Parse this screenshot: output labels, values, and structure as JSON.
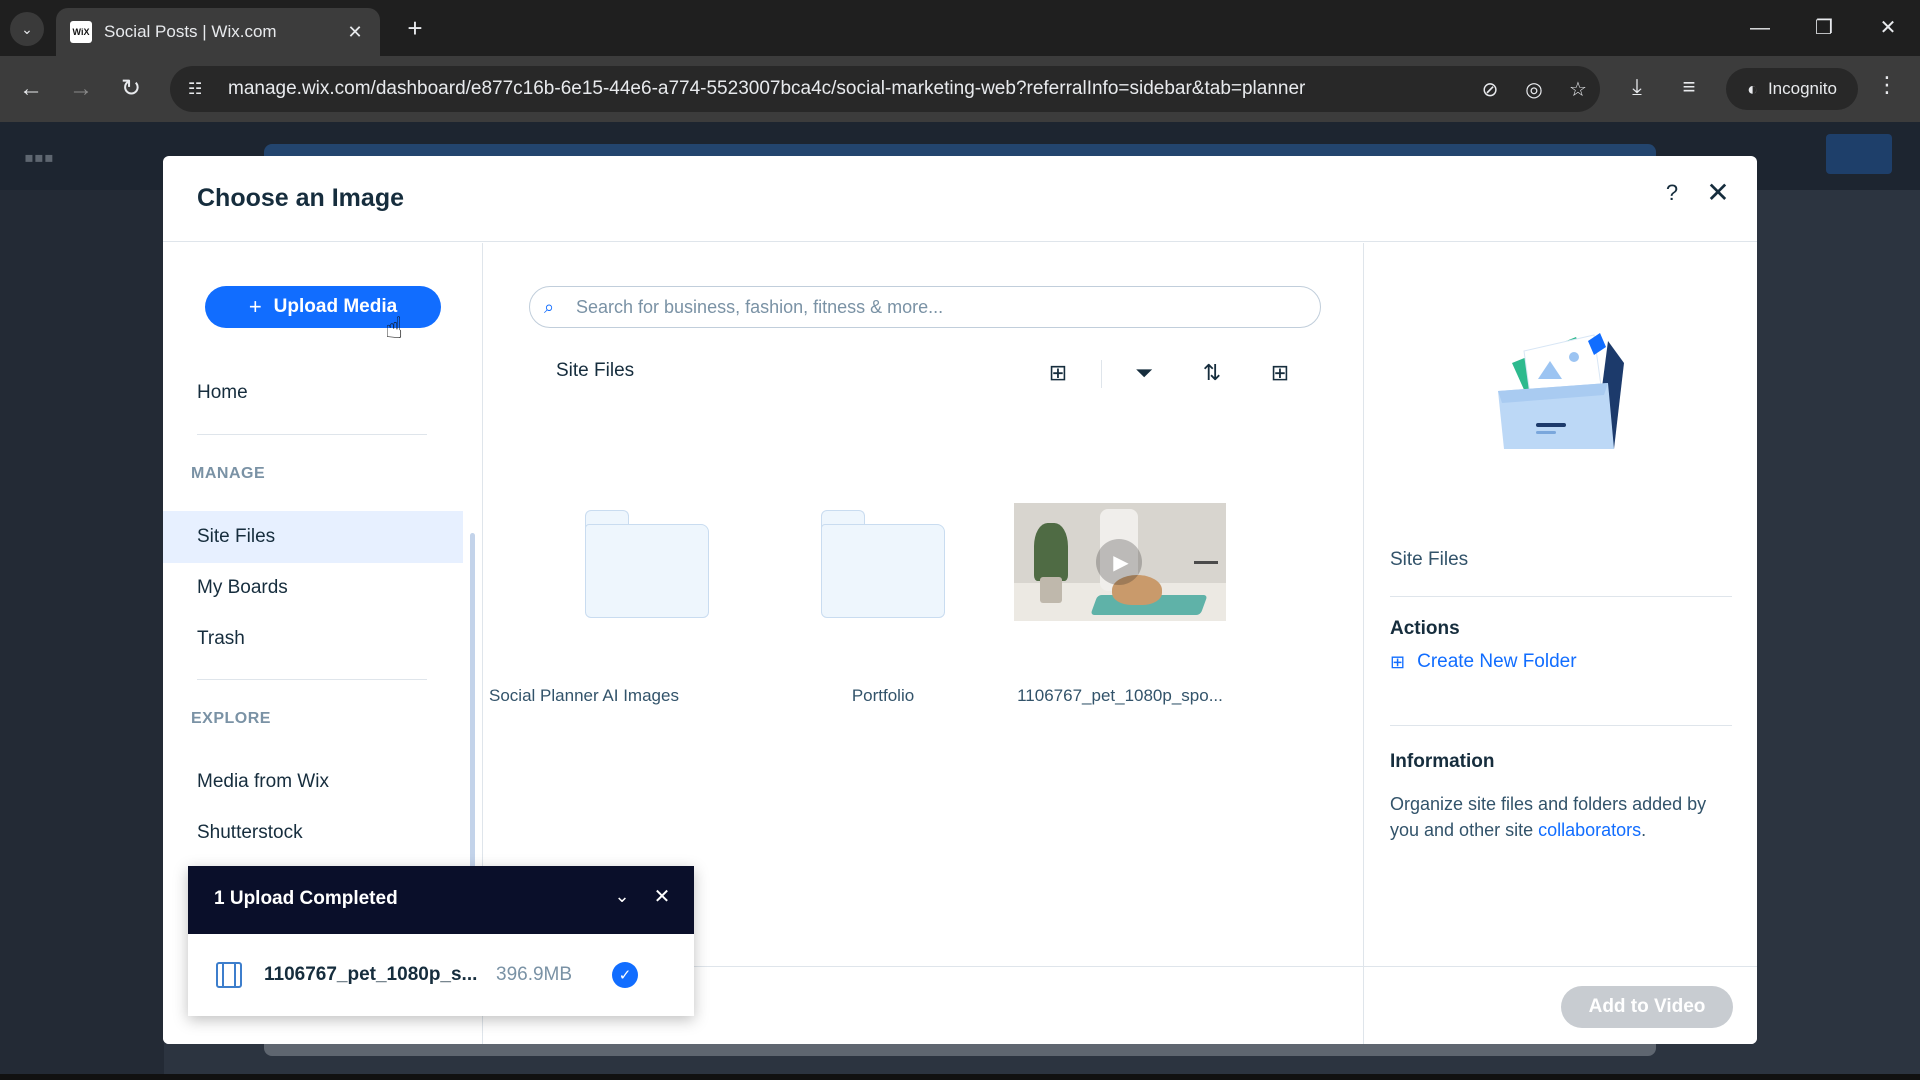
{
  "browser": {
    "tab_title": "Social Posts | Wix.com",
    "favicon_text": "WiX",
    "url": "manage.wix.com/dashboard/e877c16b-6e15-44e6-a774-5523007bca4c/social-marketing-web?referralInfo=sidebar&tab=planner",
    "profile_label": "Incognito"
  },
  "modal": {
    "title": "Choose an Image",
    "upload_label": "Upload Media",
    "nav": {
      "home": "Home",
      "manage_section": "MANAGE",
      "site_files": "Site Files",
      "my_boards": "My Boards",
      "trash": "Trash",
      "explore_section": "EXPLORE",
      "media_from_wix": "Media from Wix",
      "shutterstock": "Shutterstock"
    },
    "search": {
      "placeholder": "Search for business, fashion, fitness & more..."
    },
    "breadcrumb": "Site Files",
    "items": [
      {
        "label": "Social Planner AI Images",
        "type": "folder"
      },
      {
        "label": "Portfolio",
        "type": "folder"
      },
      {
        "label": "1106767_pet_1080p_spo...",
        "type": "video"
      }
    ],
    "details": {
      "title": "Site Files",
      "actions_heading": "Actions",
      "create_folder": "Create New Folder",
      "info_heading": "Information",
      "info_text": "Organize site files and folders added by you and other site ",
      "info_link": "collaborators",
      "info_end": "."
    },
    "add_button": "Add to Video"
  },
  "upload_toast": {
    "title": "1 Upload Completed",
    "file_name": "1106767_pet_1080p_s...",
    "file_size": "396.9MB"
  },
  "colors": {
    "accent": "#116dff",
    "toast_header": "#0a0f2a",
    "disabled_button": "#c8ccd1"
  }
}
